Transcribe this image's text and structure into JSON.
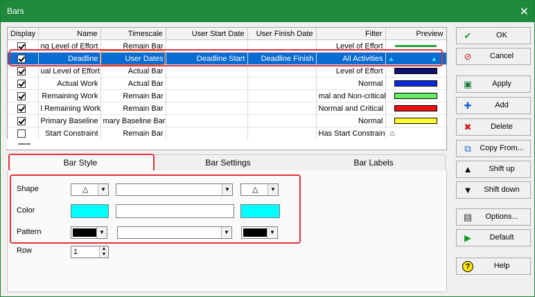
{
  "window": {
    "title": "Bars",
    "close_label": "✕"
  },
  "grid": {
    "headers": [
      "Display",
      "Name",
      "Timescale",
      "User Start Date",
      "User Finish Date",
      "Filter",
      "Preview"
    ],
    "rows": [
      {
        "checked": true,
        "name": "ng Level of Effort",
        "timescale": "Remain Bar",
        "start": "",
        "finish": "",
        "filter": "Level of Effort",
        "preview": {
          "kind": "line",
          "color": "#1fa23a"
        }
      },
      {
        "checked": true,
        "name": "Deadline",
        "timescale": "User Dates",
        "start": "Deadline Start",
        "finish": "Deadline Finish",
        "filter": "All Activities",
        "preview": {
          "kind": "triangles",
          "color": "#33e8f0"
        },
        "selected": true
      },
      {
        "checked": true,
        "name": "ual Level of Effort",
        "timescale": "Actual Bar",
        "start": "",
        "finish": "",
        "filter": "Level of Effort",
        "preview": {
          "kind": "bar",
          "color": "#101070"
        }
      },
      {
        "checked": true,
        "name": "Actual Work",
        "timescale": "Actual Bar",
        "start": "",
        "finish": "",
        "filter": "Normal",
        "preview": {
          "kind": "bar",
          "color": "#0a2ae0"
        }
      },
      {
        "checked": true,
        "name": "Remaining Work",
        "timescale": "Remain Bar",
        "start": "",
        "finish": "",
        "filter": "mal and Non-critical",
        "preview": {
          "kind": "bar",
          "color": "#66ee66"
        }
      },
      {
        "checked": true,
        "name": "l Remaining Work",
        "timescale": "Remain Bar",
        "start": "",
        "finish": "",
        "filter": "Normal and Critical",
        "preview": {
          "kind": "bar",
          "color": "#ee1010"
        }
      },
      {
        "checked": true,
        "name": "Primary Baseline",
        "timescale": "mary Baseline Bar",
        "start": "",
        "finish": "",
        "filter": "Normal",
        "preview": {
          "kind": "bar",
          "color": "#ffff33"
        }
      },
      {
        "checked": false,
        "name": "Start Constraint",
        "timescale": "Remain Bar",
        "start": "",
        "finish": "",
        "filter": "Has Start Constraint",
        "preview": {
          "kind": "symbol",
          "color": "#ffffff"
        }
      }
    ]
  },
  "tabs": [
    "Bar Style",
    "Bar Settings",
    "Bar Labels"
  ],
  "style_panel": {
    "shape_label": "Shape",
    "color_label": "Color",
    "pattern_label": "Pattern",
    "row_label": "Row",
    "start_shape": "△",
    "end_shape": "△",
    "middle_shape": "",
    "start_color": "#00ffff",
    "middle_color": "#ffffff",
    "end_color": "#00ffff",
    "row_value": "1",
    "arrow_down": "▼",
    "arrow_up": "▲"
  },
  "buttons": [
    {
      "label": "OK",
      "icon": "check-icon"
    },
    {
      "label": "Cancel",
      "icon": "cancel-icon"
    },
    {
      "label": "Apply",
      "icon": "apply-icon"
    },
    {
      "label": "Add",
      "icon": "plus-icon"
    },
    {
      "label": "Delete",
      "icon": "delete-x-icon"
    },
    {
      "label": "Copy From...",
      "icon": "copy-icon"
    },
    {
      "label": "Shift up",
      "icon": "triangle-up-icon"
    },
    {
      "label": "Shift down",
      "icon": "triangle-down-icon"
    },
    {
      "label": "Options...",
      "icon": "options-icon"
    },
    {
      "label": "Default",
      "icon": "play-icon"
    },
    {
      "label": "Help",
      "icon": "help-icon"
    }
  ]
}
